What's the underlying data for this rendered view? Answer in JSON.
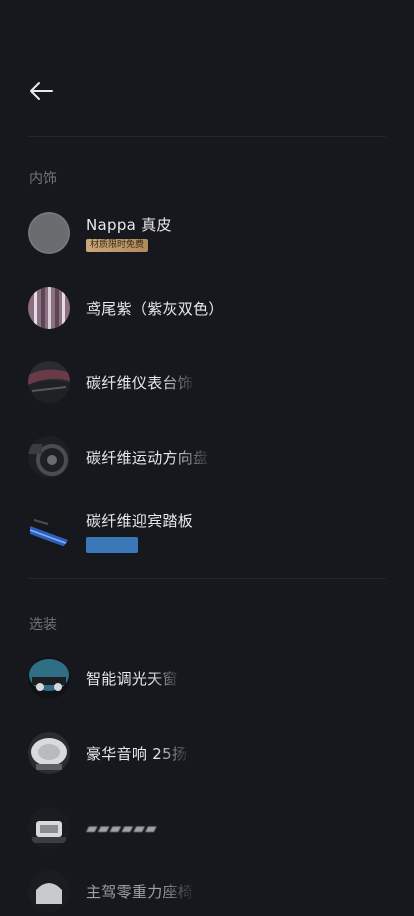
{
  "nav": {
    "back_icon": "arrow-left-icon"
  },
  "interior": {
    "section_title": "内饰",
    "items": [
      {
        "label": "Nappa 真皮",
        "badge": "材质限时免费"
      },
      {
        "label": "鸢尾紫（紫灰双色）"
      },
      {
        "label": "碳纤维仪表台饰"
      },
      {
        "label": "碳纤维运动方向盘"
      },
      {
        "label": "碳纤维迎宾踏板"
      }
    ]
  },
  "options": {
    "section_title": "选装",
    "items": [
      {
        "label": "智能调光天窗"
      },
      {
        "label": "豪华音响 25扬"
      },
      {
        "label": "▰▰▰▰▰▰"
      },
      {
        "label": "主驾零重力座椅"
      }
    ]
  },
  "colors": {
    "background": "#16181d",
    "badge_gold": "#c9a77a",
    "tag_blue": "#3a78b8"
  }
}
